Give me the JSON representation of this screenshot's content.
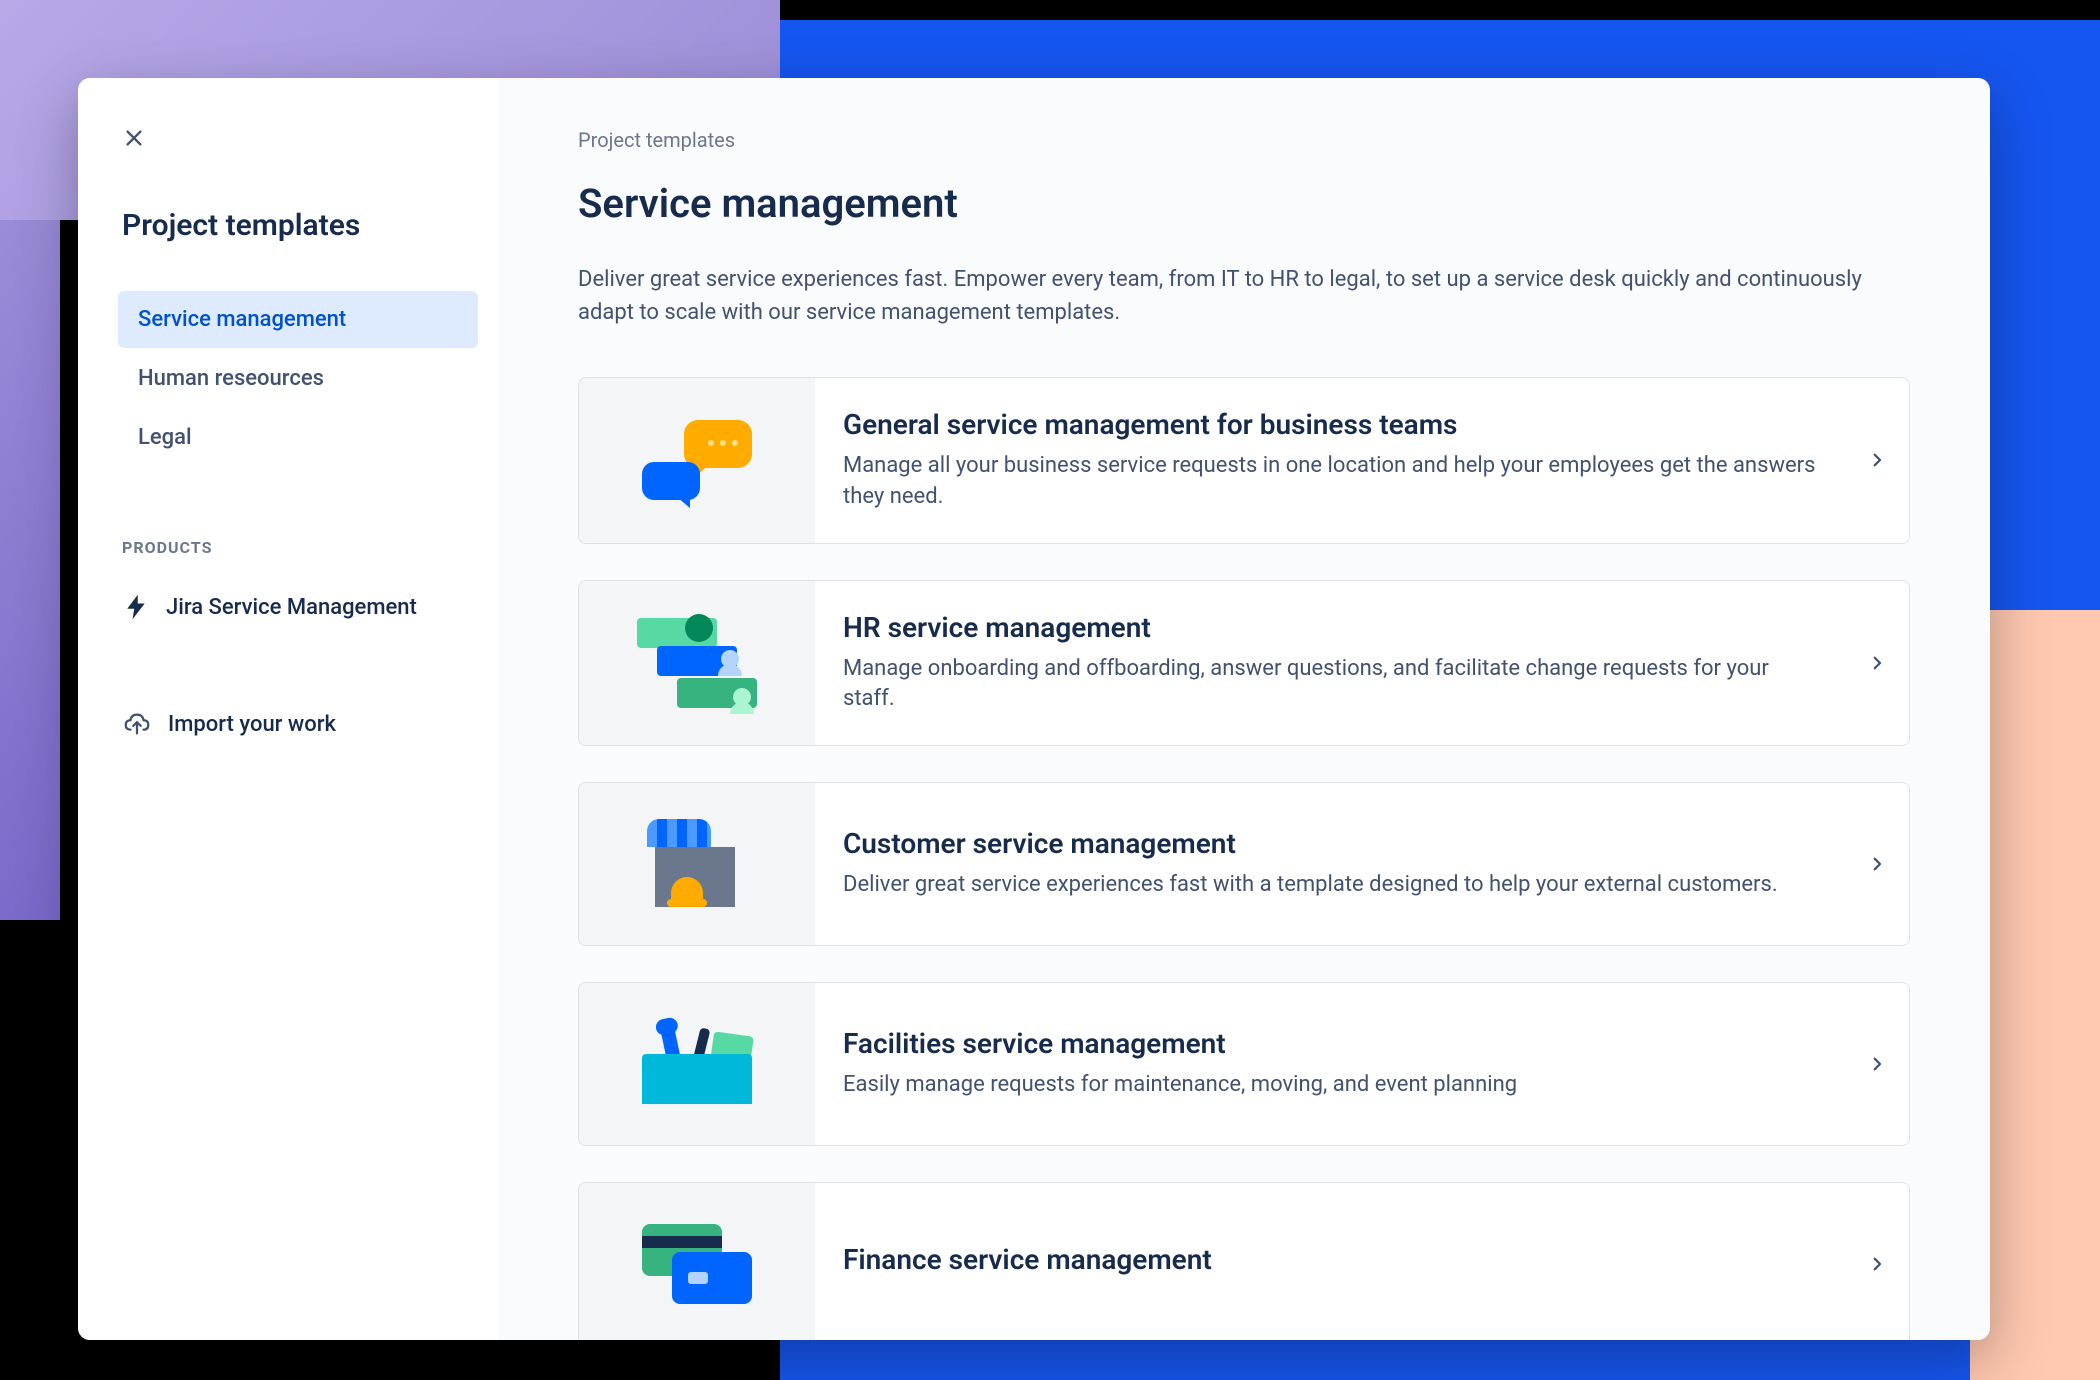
{
  "sidebar": {
    "title": "Project templates",
    "nav": [
      {
        "label": "Service management",
        "active": true
      },
      {
        "label": "Human reseources",
        "active": false
      },
      {
        "label": "Legal",
        "active": false
      }
    ],
    "products_label": "PRODUCTS",
    "products": [
      {
        "label": "Jira Service Management",
        "icon": "lightning-icon"
      }
    ],
    "import_label": "Import your work"
  },
  "main": {
    "breadcrumb": "Project templates",
    "title": "Service management",
    "description": "Deliver great service experiences fast. Empower every team, from IT to HR to legal, to set up a service desk quickly and continuously adapt to scale with our service management templates.",
    "templates": [
      {
        "title": "General service management for business teams",
        "description": "Manage all your business service requests in one location and help your employees get the answers they need.",
        "icon": "chat-bubbles-icon"
      },
      {
        "title": "HR service management",
        "description": "Manage onboarding and offboarding, answer questions, and facilitate change requests for your staff.",
        "icon": "people-cards-icon"
      },
      {
        "title": "Customer service management",
        "description": "Deliver great service experiences fast with a template designed to help your external customers.",
        "icon": "storefront-bell-icon"
      },
      {
        "title": "Facilities service management",
        "description": "Easily manage requests for maintenance, moving, and event planning",
        "icon": "toolbox-icon"
      },
      {
        "title": "Finance service management",
        "description": "",
        "icon": "credit-cards-icon"
      }
    ]
  }
}
